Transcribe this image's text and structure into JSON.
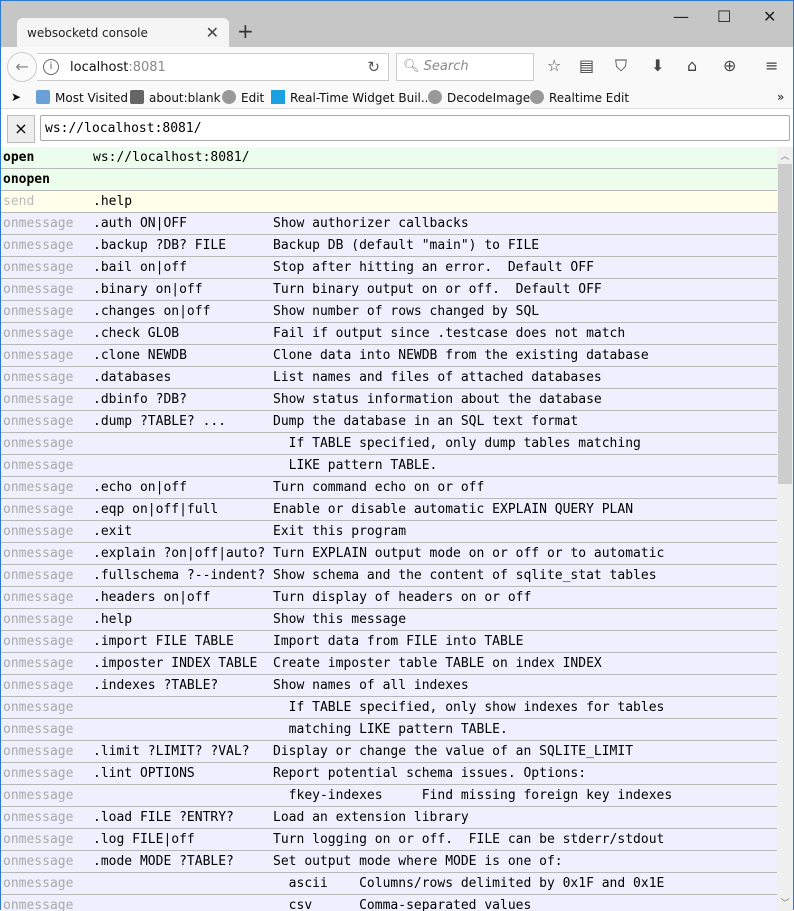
{
  "window": {
    "tab_title": "websocketd console",
    "new_tab": "+",
    "minimize": "—",
    "maximize": "☐",
    "close": "✕"
  },
  "nav": {
    "url_host": "localhost",
    "url_port": ":8081",
    "search_placeholder": "Search"
  },
  "bookmarks": [
    "Most Visited",
    "about:blank",
    "Edit",
    "Real-Time Widget Buil...",
    "DecodeImage",
    "Realtime Edit"
  ],
  "bookmarks_overflow": "»",
  "console": {
    "close_label": "×",
    "ws_url": "ws://localhost:8081/"
  },
  "colors": {
    "open_bg": "#edfded",
    "send_bg": "#fefeea",
    "message_bg": "#efeffd"
  },
  "rows": [
    {
      "type": "open",
      "label": "open",
      "text": "ws://localhost:8081/"
    },
    {
      "type": "open",
      "label": "onopen",
      "text": ""
    },
    {
      "type": "send",
      "label": "send",
      "text": ".help"
    },
    {
      "type": "msg",
      "label": "onmessage",
      "text": ".auth ON|OFF           Show authorizer callbacks"
    },
    {
      "type": "msg",
      "label": "onmessage",
      "text": ".backup ?DB? FILE      Backup DB (default \"main\") to FILE"
    },
    {
      "type": "msg",
      "label": "onmessage",
      "text": ".bail on|off           Stop after hitting an error.  Default OFF"
    },
    {
      "type": "msg",
      "label": "onmessage",
      "text": ".binary on|off         Turn binary output on or off.  Default OFF"
    },
    {
      "type": "msg",
      "label": "onmessage",
      "text": ".changes on|off        Show number of rows changed by SQL"
    },
    {
      "type": "msg",
      "label": "onmessage",
      "text": ".check GLOB            Fail if output since .testcase does not match"
    },
    {
      "type": "msg",
      "label": "onmessage",
      "text": ".clone NEWDB           Clone data into NEWDB from the existing database"
    },
    {
      "type": "msg",
      "label": "onmessage",
      "text": ".databases             List names and files of attached databases"
    },
    {
      "type": "msg",
      "label": "onmessage",
      "text": ".dbinfo ?DB?           Show status information about the database"
    },
    {
      "type": "msg",
      "label": "onmessage",
      "text": ".dump ?TABLE? ...      Dump the database in an SQL text format"
    },
    {
      "type": "msg",
      "label": "onmessage",
      "text": "                         If TABLE specified, only dump tables matching"
    },
    {
      "type": "msg",
      "label": "onmessage",
      "text": "                         LIKE pattern TABLE."
    },
    {
      "type": "msg",
      "label": "onmessage",
      "text": ".echo on|off           Turn command echo on or off"
    },
    {
      "type": "msg",
      "label": "onmessage",
      "text": ".eqp on|off|full       Enable or disable automatic EXPLAIN QUERY PLAN"
    },
    {
      "type": "msg",
      "label": "onmessage",
      "text": ".exit                  Exit this program"
    },
    {
      "type": "msg",
      "label": "onmessage",
      "text": ".explain ?on|off|auto? Turn EXPLAIN output mode on or off or to automatic"
    },
    {
      "type": "msg",
      "label": "onmessage",
      "text": ".fullschema ?--indent? Show schema and the content of sqlite_stat tables"
    },
    {
      "type": "msg",
      "label": "onmessage",
      "text": ".headers on|off        Turn display of headers on or off"
    },
    {
      "type": "msg",
      "label": "onmessage",
      "text": ".help                  Show this message"
    },
    {
      "type": "msg",
      "label": "onmessage",
      "text": ".import FILE TABLE     Import data from FILE into TABLE"
    },
    {
      "type": "msg",
      "label": "onmessage",
      "text": ".imposter INDEX TABLE  Create imposter table TABLE on index INDEX"
    },
    {
      "type": "msg",
      "label": "onmessage",
      "text": ".indexes ?TABLE?       Show names of all indexes"
    },
    {
      "type": "msg",
      "label": "onmessage",
      "text": "                         If TABLE specified, only show indexes for tables"
    },
    {
      "type": "msg",
      "label": "onmessage",
      "text": "                         matching LIKE pattern TABLE."
    },
    {
      "type": "msg",
      "label": "onmessage",
      "text": ".limit ?LIMIT? ?VAL?   Display or change the value of an SQLITE_LIMIT"
    },
    {
      "type": "msg",
      "label": "onmessage",
      "text": ".lint OPTIONS          Report potential schema issues. Options:"
    },
    {
      "type": "msg",
      "label": "onmessage",
      "text": "                         fkey-indexes     Find missing foreign key indexes"
    },
    {
      "type": "msg",
      "label": "onmessage",
      "text": ".load FILE ?ENTRY?     Load an extension library"
    },
    {
      "type": "msg",
      "label": "onmessage",
      "text": ".log FILE|off          Turn logging on or off.  FILE can be stderr/stdout"
    },
    {
      "type": "msg",
      "label": "onmessage",
      "text": ".mode MODE ?TABLE?     Set output mode where MODE is one of:"
    },
    {
      "type": "msg",
      "label": "onmessage",
      "text": "                         ascii    Columns/rows delimited by 0x1F and 0x1E"
    },
    {
      "type": "msg",
      "label": "onmessage",
      "text": "                         csv      Comma-separated values"
    }
  ]
}
